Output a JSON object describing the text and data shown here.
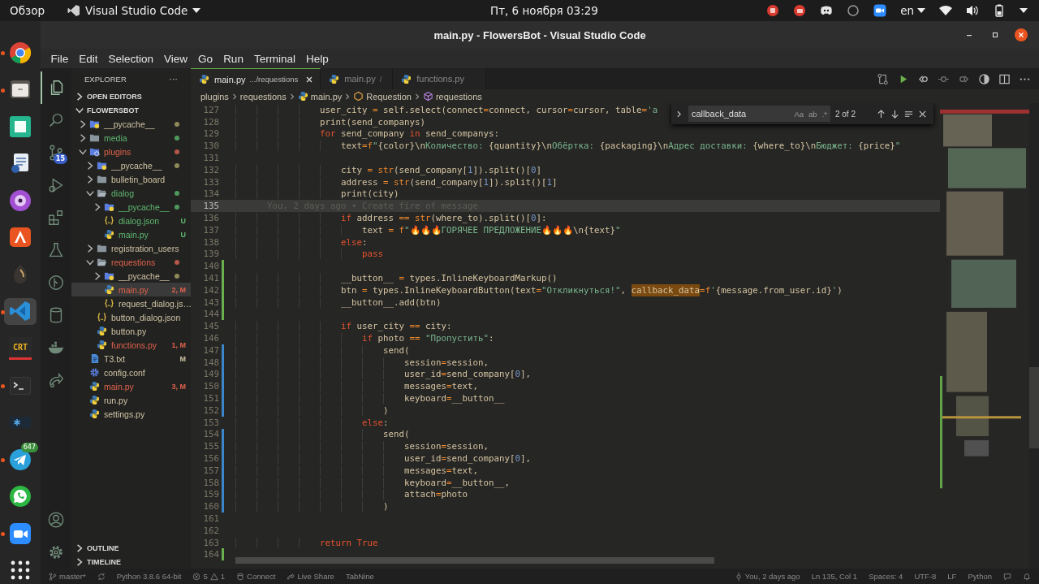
{
  "topbar": {
    "activities": "Обзор",
    "app": "Visual Studio Code",
    "clock": "Пт, 6 ноября  03:29",
    "lang": "en"
  },
  "dock": [
    {
      "kind": "chrome",
      "running": true,
      "selected": false
    },
    {
      "kind": "files",
      "running": true,
      "selected": false
    },
    {
      "kind": "green",
      "running": false,
      "selected": false
    },
    {
      "kind": "doc",
      "running": false,
      "selected": false
    },
    {
      "kind": "disc",
      "running": false,
      "selected": false
    },
    {
      "kind": "store",
      "running": false,
      "selected": false
    },
    {
      "kind": "drop",
      "running": false,
      "selected": false
    },
    {
      "kind": "vscode",
      "running": true,
      "selected": true
    },
    {
      "kind": "crt",
      "label": "CRT",
      "running": false,
      "selected": false
    },
    {
      "kind": "terminal",
      "running": true,
      "selected": false
    },
    {
      "kind": "star",
      "running": false,
      "selected": false
    },
    {
      "kind": "telegram",
      "badge": "647",
      "running": true,
      "selected": false
    },
    {
      "kind": "whatsapp",
      "running": false,
      "selected": false
    },
    {
      "kind": "zoom",
      "running": true,
      "selected": false
    },
    {
      "kind": "grid",
      "running": false,
      "selected": false
    }
  ],
  "window": {
    "title": "main.py - FlowersBot - Visual Studio Code"
  },
  "menu": [
    "File",
    "Edit",
    "Selection",
    "View",
    "Go",
    "Run",
    "Terminal",
    "Help"
  ],
  "activity_bar": [
    {
      "kind": "explorer",
      "selected": true
    },
    {
      "kind": "search",
      "selected": false
    },
    {
      "kind": "scm",
      "selected": false,
      "badge": "15"
    },
    {
      "kind": "debug",
      "selected": false
    },
    {
      "kind": "extensions",
      "selected": false
    },
    {
      "kind": "flask",
      "selected": false
    },
    {
      "kind": "graph",
      "selected": false
    },
    {
      "kind": "database",
      "selected": false
    },
    {
      "kind": "docker",
      "selected": false
    },
    {
      "kind": "share",
      "selected": false
    }
  ],
  "sidebar": {
    "title": "EXPLORER",
    "more": "···",
    "sections_top": [
      {
        "label": "OPEN EDITORS",
        "expanded": false
      }
    ],
    "root": {
      "label": "FLOWERSBOT",
      "expanded": true
    },
    "tree": [
      {
        "name": "__pycache__",
        "kind": "folder-py",
        "expanded": false,
        "selected": false,
        "modified": false,
        "untracked": false,
        "color": "#8f8a5a"
      },
      {
        "name": "media",
        "kind": "folder",
        "expanded": false,
        "selected": false,
        "modified": false,
        "untracked": true,
        "color": "#4e9a5c"
      },
      {
        "name": "plugins",
        "kind": "folder-plugin",
        "expanded": true,
        "selected": false,
        "modified": true,
        "untracked": false,
        "color": "#b5574a",
        "children": [
          {
            "name": "__pycache__",
            "kind": "folder-py",
            "expanded": false,
            "selected": false,
            "modified": false,
            "untracked": false,
            "color": "#8f8a5a"
          },
          {
            "name": "bulletin_board",
            "kind": "folder",
            "expanded": false,
            "selected": false,
            "modified": false,
            "untracked": false
          },
          {
            "name": "dialog",
            "kind": "folder",
            "expanded": true,
            "selected": false,
            "modified": false,
            "untracked": true,
            "color": "#4e9a5c",
            "children": [
              {
                "name": "__pycache__",
                "kind": "folder-py",
                "expanded": false,
                "selected": false,
                "modified": false,
                "untracked": true,
                "color": "#4e9a5c"
              },
              {
                "name": "dialog.json",
                "kind": "json",
                "selected": false,
                "modified": false,
                "untracked": true,
                "badge": "U"
              },
              {
                "name": "main.py",
                "kind": "py",
                "selected": false,
                "modified": false,
                "untracked": true,
                "badge": "U"
              }
            ]
          },
          {
            "name": "registration_users",
            "kind": "folder",
            "expanded": false,
            "selected": false,
            "modified": false,
            "untracked": false
          },
          {
            "name": "requestions",
            "kind": "folder",
            "expanded": true,
            "selected": false,
            "modified": true,
            "untracked": false,
            "color": "#b5574a",
            "children": [
              {
                "name": "__pycache__",
                "kind": "folder-py",
                "expanded": false,
                "selected": false,
                "modified": false,
                "untracked": false,
                "color": "#8f8a5a"
              },
              {
                "name": "main.py",
                "kind": "py",
                "selected": true,
                "modified": true,
                "untracked": false,
                "badge": "2, M"
              },
              {
                "name": "request_dialog.js…",
                "kind": "json",
                "selected": false,
                "modified": false,
                "untracked": false
              }
            ]
          },
          {
            "name": "button_dialog.json",
            "kind": "json",
            "selected": false,
            "modified": false,
            "untracked": false
          },
          {
            "name": "button.py",
            "kind": "py",
            "selected": false,
            "modified": false,
            "untracked": false
          },
          {
            "name": "functions.py",
            "kind": "py",
            "selected": false,
            "modified": true,
            "untracked": false,
            "badge": "1, M"
          }
        ]
      },
      {
        "name": "T3.txt",
        "kind": "txt",
        "selected": false,
        "modified": false,
        "untracked": false,
        "badge": "M"
      },
      {
        "name": "config.conf",
        "kind": "conf",
        "selected": false,
        "modified": false,
        "untracked": false
      },
      {
        "name": "main.py",
        "kind": "py",
        "selected": false,
        "modified": true,
        "untracked": false,
        "badge": "3, M"
      },
      {
        "name": "run.py",
        "kind": "py",
        "selected": false,
        "modified": false,
        "untracked": false
      },
      {
        "name": "settings.py",
        "kind": "py",
        "selected": false,
        "modified": false,
        "untracked": false
      }
    ],
    "sections_bottom": [
      {
        "label": "OUTLINE",
        "expanded": false
      },
      {
        "label": "TIMELINE",
        "expanded": false
      }
    ]
  },
  "activity_bottom": [
    {
      "kind": "account",
      "selected": false
    },
    {
      "kind": "settings",
      "selected": false
    }
  ],
  "tabs": [
    {
      "label": "main.py",
      "path": ".../requestions",
      "selected": true
    },
    {
      "label": "main.py",
      "path": "/",
      "selected": false
    },
    {
      "label": "functions.py",
      "selected": false
    }
  ],
  "breadcrumbs": [
    {
      "label": "plugins",
      "kind": "folder"
    },
    {
      "label": "requestions",
      "kind": "folder"
    },
    {
      "label": "main.py",
      "kind": "py"
    },
    {
      "label": "Requestion",
      "kind": "class"
    },
    {
      "label": "requestions",
      "kind": "method"
    }
  ],
  "find": {
    "value": "callback_data",
    "options": [
      {
        "label": "Aa",
        "selected": false
      },
      {
        "label": "ab",
        "selected": false
      },
      {
        "label": ".*",
        "selected": false
      }
    ],
    "count": "2 of 2"
  },
  "code": [
    {
      "n": "127",
      "t": [
        {
          "kind": "plain",
          "text": "                user_city "
        },
        {
          "kind": "operator",
          "text": "="
        },
        {
          "kind": "plain",
          "text": " self.select(connect"
        },
        {
          "kind": "operator",
          "text": "="
        },
        {
          "kind": "plain",
          "text": "connect, cursor"
        },
        {
          "kind": "operator",
          "text": "="
        },
        {
          "kind": "plain",
          "text": "cursor, table"
        },
        {
          "kind": "operator",
          "text": "="
        },
        {
          "kind": "string",
          "text": "'a"
        }
      ]
    },
    {
      "n": "128",
      "t": [
        {
          "kind": "plain",
          "text": "                print(send_companys)"
        }
      ]
    },
    {
      "n": "129",
      "t": [
        {
          "kind": "keyword",
          "text": "                for"
        },
        {
          "kind": "plain",
          "text": " send_company "
        },
        {
          "kind": "keyword",
          "text": "in"
        },
        {
          "kind": "plain",
          "text": " send_companys:"
        }
      ]
    },
    {
      "n": "130",
      "t": [
        {
          "kind": "plain",
          "text": "                    text"
        },
        {
          "kind": "operator",
          "text": "="
        },
        {
          "kind": "builtin",
          "text": "f"
        },
        {
          "kind": "string",
          "text": "\""
        },
        {
          "kind": "plain",
          "text": "{color}\\n"
        },
        {
          "kind": "string",
          "text": "Количество: "
        },
        {
          "kind": "plain",
          "text": "{quantity}\\n"
        },
        {
          "kind": "string",
          "text": "Обёртка: "
        },
        {
          "kind": "plain",
          "text": "{packaging}\\n"
        },
        {
          "kind": "string",
          "text": "Адрес доставки: "
        },
        {
          "kind": "plain",
          "text": "{where_to}\\n"
        },
        {
          "kind": "string",
          "text": "Бюджет: "
        },
        {
          "kind": "plain",
          "text": "{price}"
        },
        {
          "kind": "string",
          "text": "\""
        }
      ]
    },
    {
      "n": "131"
    },
    {
      "n": "132",
      "t": [
        {
          "kind": "plain",
          "text": "                    city "
        },
        {
          "kind": "operator",
          "text": "="
        },
        {
          "kind": "builtin",
          "text": " str"
        },
        {
          "kind": "plain",
          "text": "(send_company["
        },
        {
          "kind": "number",
          "text": "1"
        },
        {
          "kind": "plain",
          "text": "]).split()["
        },
        {
          "kind": "number",
          "text": "0"
        },
        {
          "kind": "plain",
          "text": "]"
        }
      ]
    },
    {
      "n": "133",
      "t": [
        {
          "kind": "plain",
          "text": "                    address "
        },
        {
          "kind": "operator",
          "text": "="
        },
        {
          "kind": "builtin",
          "text": " str"
        },
        {
          "kind": "plain",
          "text": "(send_company["
        },
        {
          "kind": "number",
          "text": "1"
        },
        {
          "kind": "plain",
          "text": "]).split()["
        },
        {
          "kind": "number",
          "text": "1"
        },
        {
          "kind": "plain",
          "text": "]"
        }
      ]
    },
    {
      "n": "134",
      "t": [
        {
          "kind": "plain",
          "text": "                    print(city)"
        }
      ]
    },
    {
      "n": "135",
      "current": true,
      "blame": "You, 2 days ago • Create fire of message"
    },
    {
      "n": "136",
      "t": [
        {
          "kind": "keyword",
          "text": "                    if"
        },
        {
          "kind": "plain",
          "text": " address "
        },
        {
          "kind": "operator",
          "text": "=="
        },
        {
          "kind": "builtin",
          "text": " str"
        },
        {
          "kind": "plain",
          "text": "(where_to).split()["
        },
        {
          "kind": "number",
          "text": "0"
        },
        {
          "kind": "plain",
          "text": "]:"
        }
      ]
    },
    {
      "n": "137",
      "t": [
        {
          "kind": "plain",
          "text": "                        text "
        },
        {
          "kind": "operator",
          "text": "="
        },
        {
          "kind": "builtin",
          "text": " f"
        },
        {
          "kind": "string",
          "text": "\"🔥🔥🔥ГОРЯЧЕЕ ПРЕДЛОЖЕНИЕ🔥🔥🔥"
        },
        {
          "kind": "plain",
          "text": "\\n{text}"
        },
        {
          "kind": "string",
          "text": "\""
        }
      ]
    },
    {
      "n": "138",
      "t": [
        {
          "kind": "keyword",
          "text": "                    else"
        },
        {
          "kind": "plain",
          "text": ":"
        }
      ]
    },
    {
      "n": "139",
      "t": [
        {
          "kind": "keyword",
          "text": "                        pass"
        }
      ]
    },
    {
      "n": "140",
      "added": true
    },
    {
      "n": "141",
      "t": [
        {
          "kind": "plain",
          "text": "                    __button__ "
        },
        {
          "kind": "operator",
          "text": "="
        },
        {
          "kind": "plain",
          "text": " types.InlineKeyboardMarkup()"
        }
      ],
      "added": true
    },
    {
      "n": "142",
      "t": [
        {
          "kind": "plain",
          "text": "                    btn "
        },
        {
          "kind": "operator",
          "text": "="
        },
        {
          "kind": "plain",
          "text": " types.InlineKeyboardButton(text"
        },
        {
          "kind": "operator",
          "text": "="
        },
        {
          "kind": "string",
          "text": "\"Откликнуться!\""
        },
        {
          "kind": "plain",
          "text": ", "
        },
        {
          "kind": "match",
          "text": "callback_data"
        },
        {
          "kind": "operator",
          "text": "="
        },
        {
          "kind": "builtin",
          "text": "f"
        },
        {
          "kind": "string",
          "text": "'"
        },
        {
          "kind": "plain",
          "text": "{message.from_user.id}"
        },
        {
          "kind": "string",
          "text": "'"
        },
        {
          "kind": "plain",
          "text": ")"
        }
      ],
      "added": true
    },
    {
      "n": "143",
      "t": [
        {
          "kind": "plain",
          "text": "                    __button__.add(btn)"
        }
      ],
      "added": true
    },
    {
      "n": "144",
      "added": true
    },
    {
      "n": "145",
      "t": [
        {
          "kind": "keyword",
          "text": "                    if"
        },
        {
          "kind": "plain",
          "text": " user_city "
        },
        {
          "kind": "operator",
          "text": "=="
        },
        {
          "kind": "plain",
          "text": " city:"
        }
      ]
    },
    {
      "n": "146",
      "t": [
        {
          "kind": "keyword",
          "text": "                        if"
        },
        {
          "kind": "plain",
          "text": " photo "
        },
        {
          "kind": "operator",
          "text": "=="
        },
        {
          "kind": "string",
          "text": " \"Пропустить\""
        },
        {
          "kind": "plain",
          "text": ":"
        }
      ]
    },
    {
      "n": "147",
      "t": [
        {
          "kind": "plain",
          "text": "                            send("
        }
      ],
      "modified": true
    },
    {
      "n": "148",
      "t": [
        {
          "kind": "plain",
          "text": "                                session"
        },
        {
          "kind": "operator",
          "text": "="
        },
        {
          "kind": "plain",
          "text": "session,"
        }
      ],
      "modified": true
    },
    {
      "n": "149",
      "t": [
        {
          "kind": "plain",
          "text": "                                user_id"
        },
        {
          "kind": "operator",
          "text": "="
        },
        {
          "kind": "plain",
          "text": "send_company["
        },
        {
          "kind": "number",
          "text": "0"
        },
        {
          "kind": "plain",
          "text": "],"
        }
      ],
      "modified": true
    },
    {
      "n": "150",
      "t": [
        {
          "kind": "plain",
          "text": "                                messages"
        },
        {
          "kind": "operator",
          "text": "="
        },
        {
          "kind": "plain",
          "text": "text,"
        }
      ],
      "modified": true
    },
    {
      "n": "151",
      "t": [
        {
          "kind": "plain",
          "text": "                                keyboard"
        },
        {
          "kind": "operator",
          "text": "="
        },
        {
          "kind": "plain",
          "text": "__button__"
        }
      ],
      "modified": true
    },
    {
      "n": "152",
      "t": [
        {
          "kind": "plain",
          "text": "                            )"
        }
      ],
      "modified": true
    },
    {
      "n": "153",
      "t": [
        {
          "kind": "keyword",
          "text": "                        else"
        },
        {
          "kind": "plain",
          "text": ":"
        }
      ]
    },
    {
      "n": "154",
      "t": [
        {
          "kind": "plain",
          "text": "                            send("
        }
      ],
      "modified": true
    },
    {
      "n": "155",
      "t": [
        {
          "kind": "plain",
          "text": "                                session"
        },
        {
          "kind": "operator",
          "text": "="
        },
        {
          "kind": "plain",
          "text": "session,"
        }
      ],
      "modified": true
    },
    {
      "n": "156",
      "t": [
        {
          "kind": "plain",
          "text": "                                user_id"
        },
        {
          "kind": "operator",
          "text": "="
        },
        {
          "kind": "plain",
          "text": "send_company["
        },
        {
          "kind": "number",
          "text": "0"
        },
        {
          "kind": "plain",
          "text": "],"
        }
      ],
      "modified": true
    },
    {
      "n": "157",
      "t": [
        {
          "kind": "plain",
          "text": "                                messages"
        },
        {
          "kind": "operator",
          "text": "="
        },
        {
          "kind": "plain",
          "text": "text,"
        }
      ],
      "modified": true
    },
    {
      "n": "158",
      "t": [
        {
          "kind": "plain",
          "text": "                                keyboard"
        },
        {
          "kind": "operator",
          "text": "="
        },
        {
          "kind": "plain",
          "text": "__button__,"
        }
      ],
      "modified": true
    },
    {
      "n": "159",
      "t": [
        {
          "kind": "plain",
          "text": "                                attach"
        },
        {
          "kind": "operator",
          "text": "="
        },
        {
          "kind": "plain",
          "text": "photo"
        }
      ],
      "modified": true
    },
    {
      "n": "160",
      "t": [
        {
          "kind": "plain",
          "text": "                            )"
        }
      ],
      "modified": true
    },
    {
      "n": "161"
    },
    {
      "n": "162"
    },
    {
      "n": "163",
      "t": [
        {
          "kind": "keyword",
          "text": "                return"
        },
        {
          "kind": "keyword",
          "text": " True"
        }
      ]
    },
    {
      "n": "164",
      "added": true
    }
  ],
  "status_bar": {
    "left": [
      {
        "kind": "branch",
        "label": "master*"
      },
      {
        "kind": "sync"
      },
      {
        "kind": "text",
        "label": "Python 3.8.6 64-bit"
      },
      {
        "kind": "problems",
        "errors": "5",
        "warnings": "1"
      },
      {
        "kind": "db",
        "label": "Connect"
      },
      {
        "kind": "share",
        "label": "Live Share"
      },
      {
        "kind": "text",
        "label": "TabNine"
      }
    ],
    "right": [
      {
        "kind": "blame",
        "label": "You, 2 days ago"
      },
      {
        "kind": "text",
        "label": "Ln 135, Col 1"
      },
      {
        "kind": "text",
        "label": "Spaces: 4"
      },
      {
        "kind": "text",
        "label": "UTF-8"
      },
      {
        "kind": "text",
        "label": "LF"
      },
      {
        "kind": "text",
        "label": "Python"
      },
      {
        "kind": "feedback"
      },
      {
        "kind": "bell"
      }
    ]
  }
}
